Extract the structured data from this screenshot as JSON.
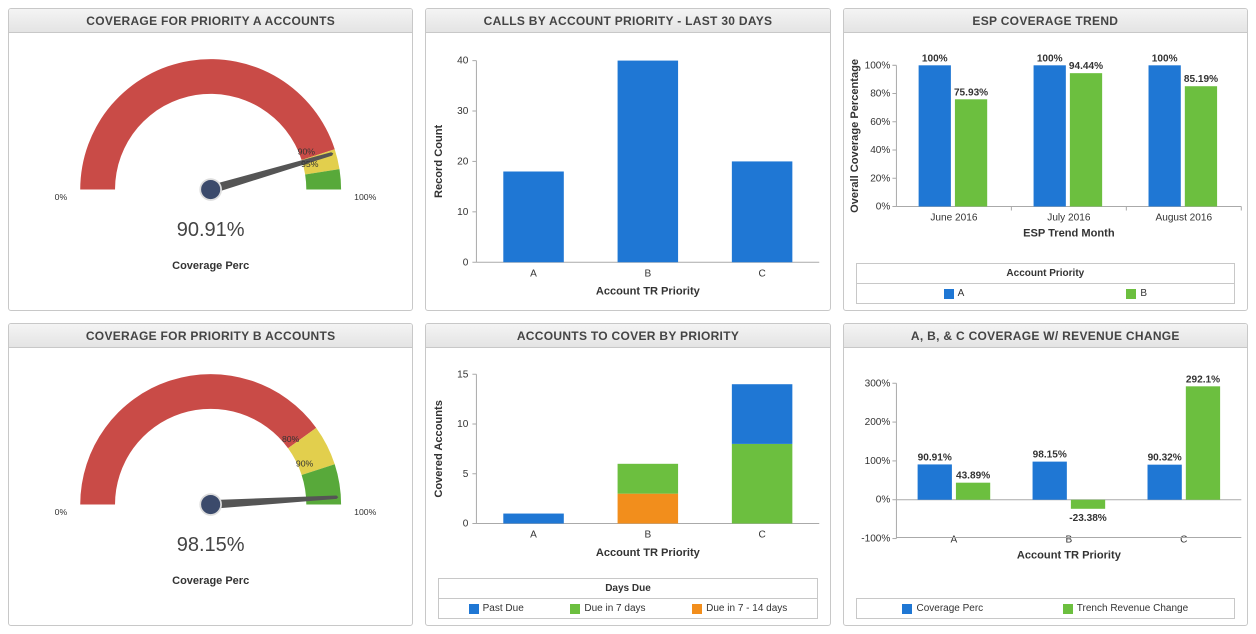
{
  "panels": {
    "gaugeA": {
      "title": "COVERAGE FOR PRIORITY A ACCOUNTS",
      "valueText": "90.91%",
      "caption": "Coverage Perc",
      "tickMin": "0%",
      "tickMax": "100%",
      "mark1": "90%",
      "mark2": "95%"
    },
    "gaugeB": {
      "title": "COVERAGE FOR PRIORITY B ACCOUNTS",
      "valueText": "98.15%",
      "caption": "Coverage Perc",
      "tickMin": "0%",
      "tickMax": "100%",
      "mark1": "80%",
      "mark2": "90%"
    },
    "calls": {
      "title": "CALLS BY ACCOUNT PRIORITY - LAST 30 DAYS",
      "xlabel": "Account TR Priority",
      "ylabel": "Record Count"
    },
    "cover": {
      "title": "ACCOUNTS TO COVER BY PRIORITY",
      "xlabel": "Account TR Priority",
      "ylabel": "Covered Accounts",
      "legendTitle": "Days Due"
    },
    "esp": {
      "title": "ESP COVERAGE TREND",
      "xlabel": "ESP Trend Month",
      "ylabel": "Overall Coverage Percentage",
      "legendTitle": "Account Priority"
    },
    "rev": {
      "title": "A, B, & C COVERAGE W/ REVENUE CHANGE",
      "xlabel": "Account TR Priority"
    }
  },
  "legends": {
    "cover": {
      "a": "Past Due",
      "b": "Due in 7 days",
      "c": "Due in 7 - 14 days"
    },
    "esp": {
      "a": "A",
      "b": "B"
    },
    "rev": {
      "a": "Coverage Perc",
      "b": "Trench Revenue Change"
    }
  },
  "chart_data": [
    {
      "id": "gaugeA",
      "type": "gauge",
      "title": "COVERAGE FOR PRIORITY A ACCOUNTS",
      "value": 90.91,
      "min": 0,
      "max": 100,
      "thresholds": [
        90,
        95
      ],
      "caption": "Coverage Perc"
    },
    {
      "id": "gaugeB",
      "type": "gauge",
      "title": "COVERAGE FOR PRIORITY B ACCOUNTS",
      "value": 98.15,
      "min": 0,
      "max": 100,
      "thresholds": [
        80,
        90
      ],
      "caption": "Coverage Perc"
    },
    {
      "id": "calls",
      "type": "bar",
      "title": "CALLS BY ACCOUNT PRIORITY - LAST 30 DAYS",
      "xlabel": "Account TR Priority",
      "ylabel": "Record Count",
      "categories": [
        "A",
        "B",
        "C"
      ],
      "values": [
        18,
        40,
        20
      ],
      "ylim": [
        0,
        40
      ],
      "yticks": [
        0,
        10,
        20,
        30,
        40
      ]
    },
    {
      "id": "cover",
      "type": "bar_stacked",
      "title": "ACCOUNTS TO COVER BY PRIORITY",
      "xlabel": "Account TR Priority",
      "ylabel": "Covered Accounts",
      "categories": [
        "A",
        "B",
        "C"
      ],
      "series": [
        {
          "name": "Past Due",
          "color": "#1f77d4",
          "values": [
            1,
            0,
            6
          ]
        },
        {
          "name": "Due in 7 days",
          "color": "#6cbf3f",
          "values": [
            0,
            3,
            8
          ]
        },
        {
          "name": "Due in 7 - 14 days",
          "color": "#f28e1c",
          "values": [
            0,
            3,
            0
          ]
        }
      ],
      "ylim": [
        0,
        15
      ],
      "yticks": [
        0,
        5,
        10,
        15
      ],
      "legendTitle": "Days Due"
    },
    {
      "id": "esp",
      "type": "bar_grouped",
      "title": "ESP COVERAGE TREND",
      "xlabel": "ESP Trend Month",
      "ylabel": "Overall Coverage Percentage",
      "categories": [
        "June 2016",
        "July 2016",
        "August 2016"
      ],
      "series": [
        {
          "name": "A",
          "color": "#1f77d4",
          "values": [
            100,
            100,
            100
          ],
          "labels": [
            "100%",
            "100%",
            "100%"
          ]
        },
        {
          "name": "B",
          "color": "#6cbf3f",
          "values": [
            75.93,
            94.44,
            85.19
          ],
          "labels": [
            "75.93%",
            "94.44%",
            "85.19%"
          ]
        }
      ],
      "ylim": [
        0,
        100
      ],
      "yticks": [
        0,
        20,
        40,
        60,
        80,
        100
      ],
      "legendTitle": "Account Priority"
    },
    {
      "id": "rev",
      "type": "bar_grouped",
      "title": "A, B, & C COVERAGE W/ REVENUE CHANGE",
      "xlabel": "Account TR Priority",
      "categories": [
        "A",
        "B",
        "C"
      ],
      "series": [
        {
          "name": "Coverage Perc",
          "color": "#1f77d4",
          "values": [
            90.91,
            98.15,
            90.32
          ],
          "labels": [
            "90.91%",
            "98.15%",
            "90.32%"
          ]
        },
        {
          "name": "Trench Revenue Change",
          "color": "#6cbf3f",
          "values": [
            43.89,
            -23.38,
            292.1
          ],
          "labels": [
            "43.89%",
            "-23.38%",
            "292.1%"
          ]
        }
      ],
      "ylim": [
        -100,
        300
      ],
      "yticks": [
        -100,
        0,
        100,
        200,
        300
      ]
    }
  ]
}
